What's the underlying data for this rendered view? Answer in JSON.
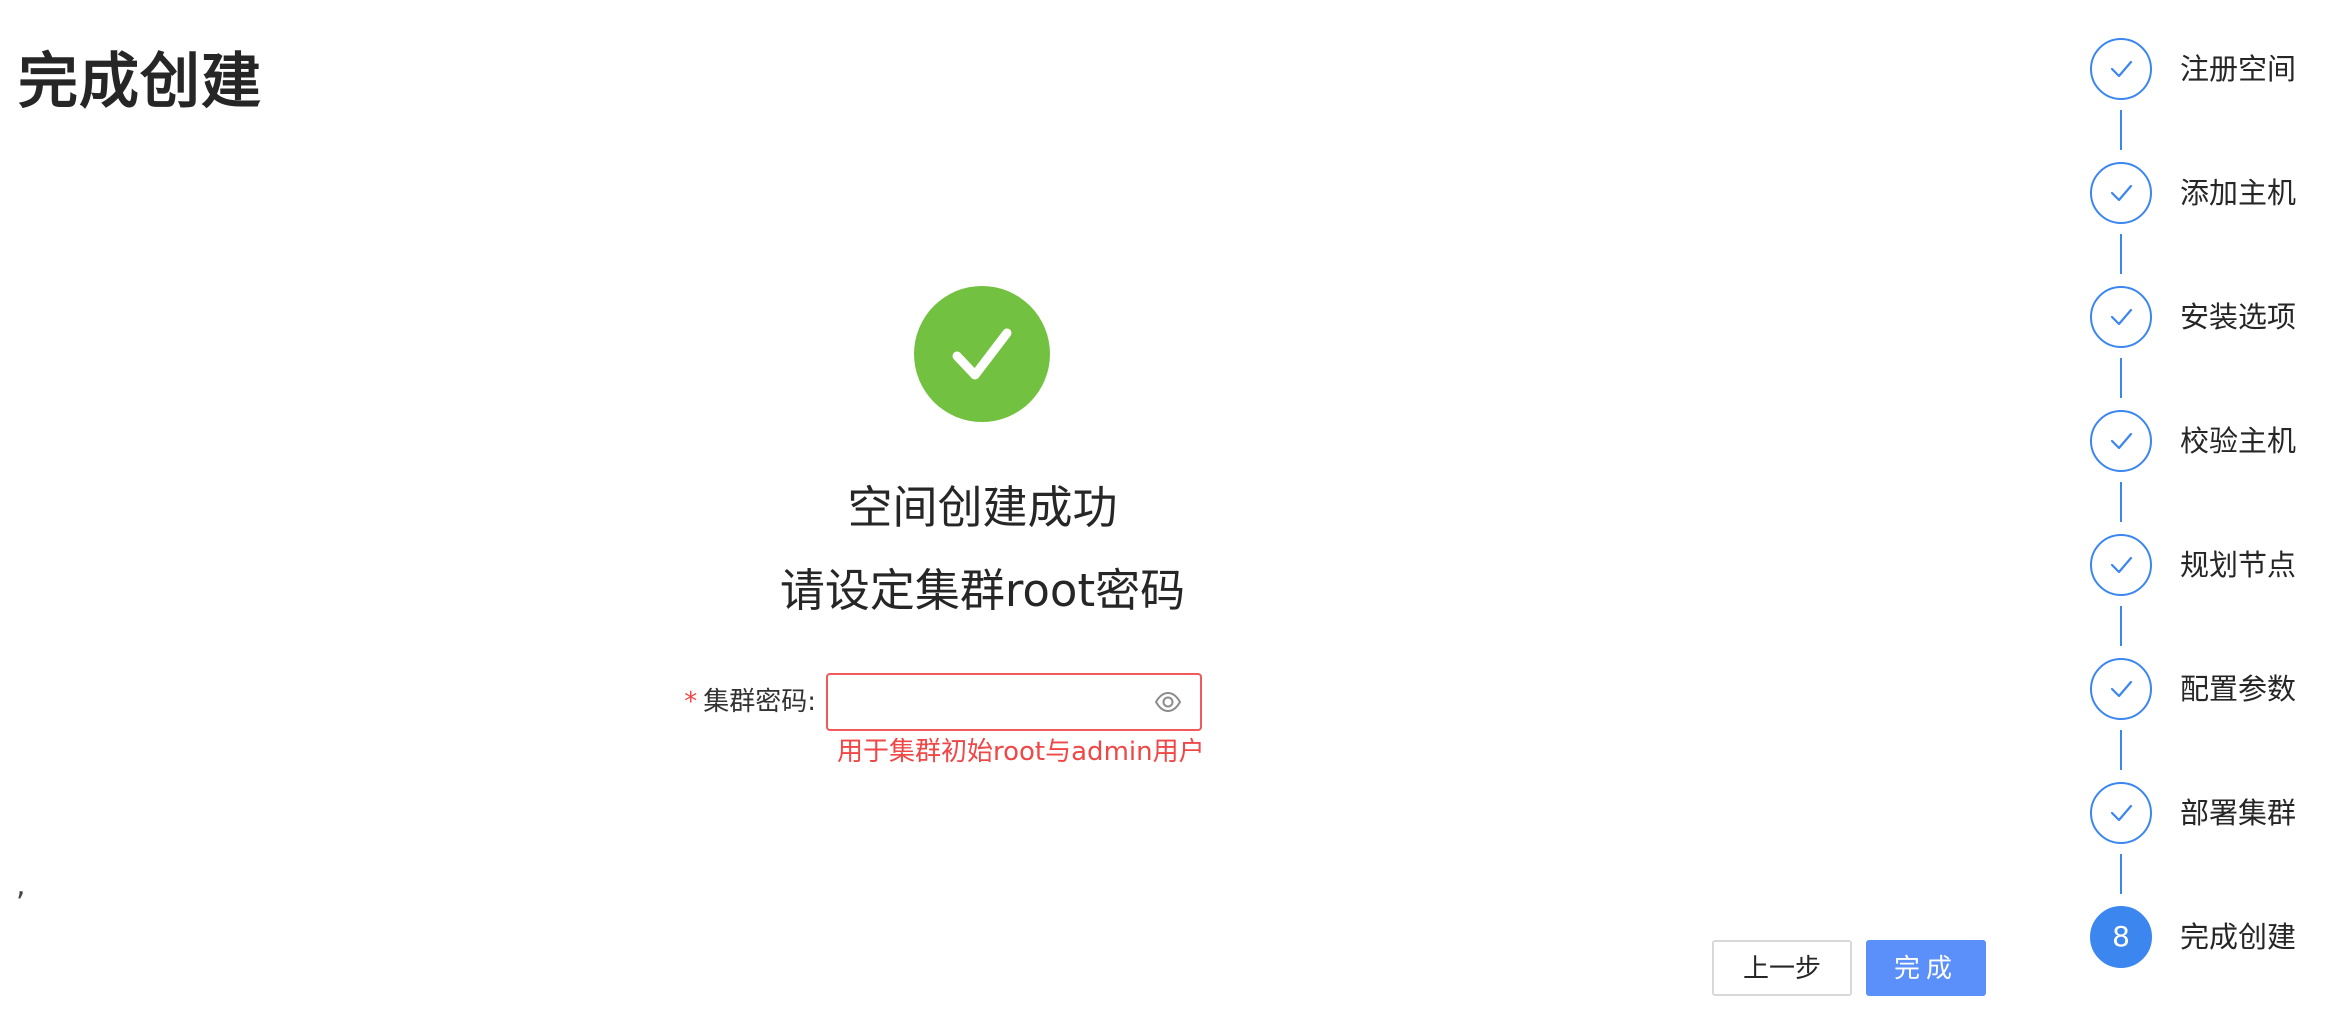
{
  "page": {
    "title": "完成创建",
    "stray_mark": ","
  },
  "result": {
    "title": "空间创建成功",
    "subtitle": "请设定集群root密码",
    "icon": "check-circle-icon",
    "icon_color": "#73c140"
  },
  "form": {
    "required_mark": "*",
    "password_label": "集群密码:",
    "password_value": "",
    "helper_text": "用于集群初始root与admin用户",
    "error_color": "#f04747",
    "toggle_icon": "eye-icon"
  },
  "actions": {
    "prev_label": "上一步",
    "finish_label": "完成",
    "primary_color": "#5b8ff9"
  },
  "steps": {
    "accent_color": "#3c86f0",
    "items": [
      {
        "label": "注册空间",
        "status": "done"
      },
      {
        "label": "添加主机",
        "status": "done"
      },
      {
        "label": "安装选项",
        "status": "done"
      },
      {
        "label": "校验主机",
        "status": "done"
      },
      {
        "label": "规划节点",
        "status": "done"
      },
      {
        "label": "配置参数",
        "status": "done"
      },
      {
        "label": "部署集群",
        "status": "done"
      },
      {
        "label": "完成创建",
        "status": "current",
        "number": "8"
      }
    ]
  }
}
